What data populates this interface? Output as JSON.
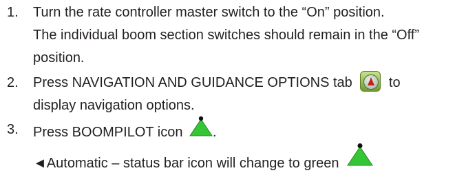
{
  "steps": [
    {
      "number": "1.",
      "lines": [
        "Turn the rate controller master switch to the “On” position.",
        "The individual boom section switches should remain in the “Off”",
        "position."
      ]
    },
    {
      "number": "2.",
      "line1_before_icon": "Press NAVIGATION AND GUIDANCE OPTIONS tab",
      "line1_after_icon": "to",
      "line2": "display navigation options.",
      "icon": "navigation-guidance-tab-icon"
    },
    {
      "number": "3.",
      "line1": "Press BOOMPILOT icon",
      "icon": "boompilot-icon",
      "sub_text": "◄Automatic – status bar icon will change to green",
      "sub_icon": "boompilot-green-status-icon"
    }
  ],
  "colors": {
    "text": "#231f20",
    "boompilot_green": "#35c635",
    "tab_green": "#6f9a2e",
    "arrow_red": "#c81e1e"
  }
}
